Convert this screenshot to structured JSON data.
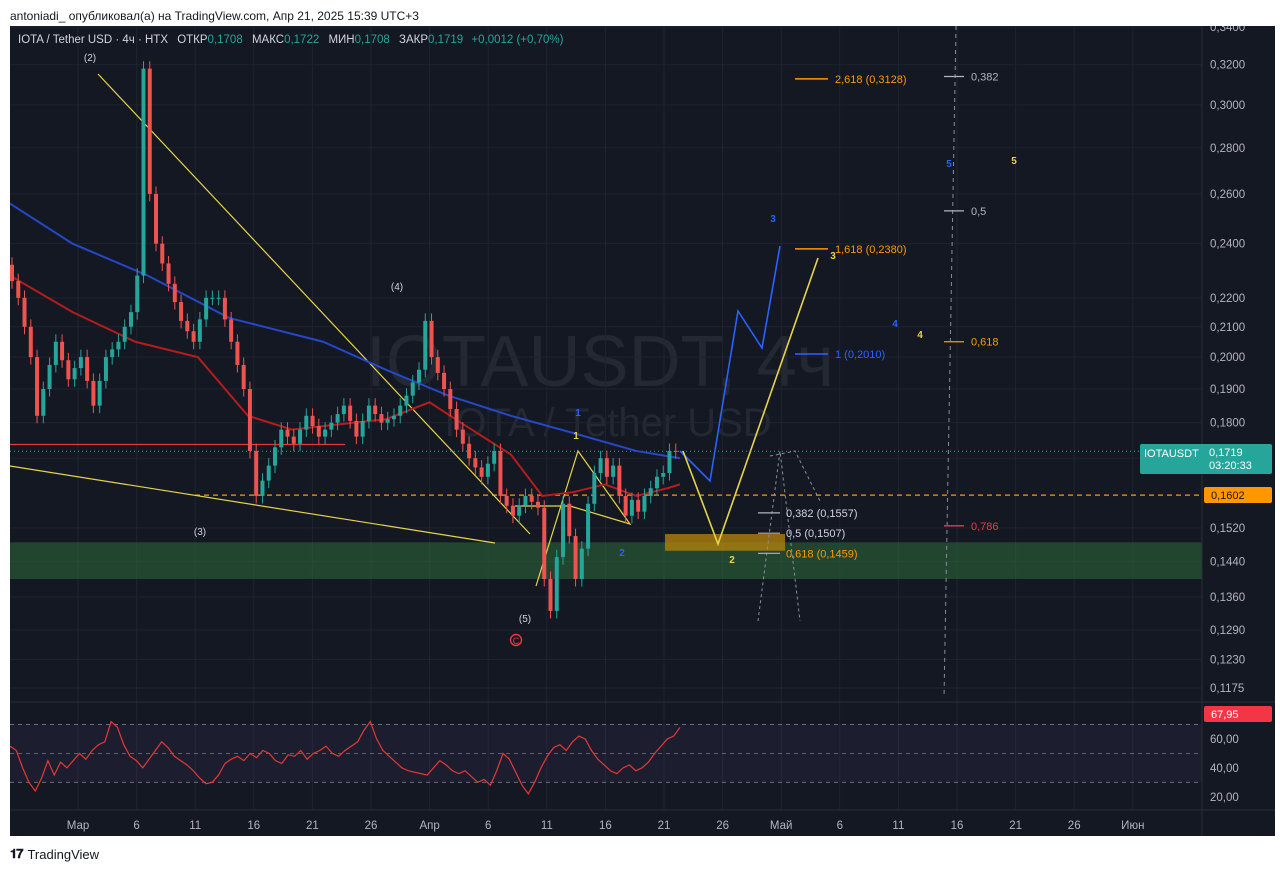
{
  "header": {
    "publisher_line": "antoniadi_ опубликовал(а) на TradingView.com, Апр 21, 2025 15:39 UTC+3"
  },
  "legend": {
    "symbol": "IOTA / Tether USD · 4ч · HTX",
    "open_label": "ОТКР",
    "open": "0,1708",
    "high_label": "МАКС",
    "high": "0,1722",
    "low_label": "МИН",
    "low": "0,1708",
    "close_label": "ЗАКР",
    "close": "0,1719",
    "change": "+0,0012 (+0,70%)"
  },
  "watermark": {
    "line1": "IOTAUSDT, 4ч",
    "line2": "IOTA / Tether USD"
  },
  "price_tag": {
    "symbol": "IOTAUSDT",
    "price": "0,1719",
    "timer": "03:20:33"
  },
  "level_tag": {
    "value": "0,1602"
  },
  "rsi_tag": {
    "value": "67,95"
  },
  "footer": {
    "brand": "TradingView"
  },
  "chart_data": {
    "type": "candlestick",
    "symbol": "IOTAUSDT",
    "timeframe": "4ч",
    "y_scale": "log",
    "y_ticks": [
      0.34,
      0.32,
      0.3,
      0.28,
      0.26,
      0.24,
      0.22,
      0.21,
      0.2,
      0.19,
      0.18,
      0.17,
      0.152,
      0.144,
      0.136,
      0.129,
      0.123,
      0.1175
    ],
    "y_tick_labels": [
      "0,3400",
      "0,3200",
      "0,3000",
      "0,2800",
      "0,2600",
      "0,2400",
      "0,2200",
      "0,2100",
      "0,2000",
      "0,1900",
      "0,1800",
      "0,1700",
      "0,1520",
      "0,1440",
      "0,1360",
      "0,1290",
      "0,1230",
      "0,1175"
    ],
    "x_tick_labels": [
      "Мар",
      "6",
      "11",
      "16",
      "21",
      "26",
      "Апр",
      "6",
      "11",
      "16",
      "21",
      "26",
      "Май",
      "6",
      "11",
      "16",
      "21",
      "26",
      "Июн"
    ],
    "last_price": 0.1719,
    "key_level": 0.1602,
    "price_path": [
      [
        0,
        0.232
      ],
      [
        2,
        0.22
      ],
      [
        4,
        0.2
      ],
      [
        5,
        0.182
      ],
      [
        6,
        0.19
      ],
      [
        8,
        0.205
      ],
      [
        10,
        0.193
      ],
      [
        12,
        0.2
      ],
      [
        14,
        0.185
      ],
      [
        16,
        0.2
      ],
      [
        18,
        0.205
      ],
      [
        20,
        0.215
      ],
      [
        21,
        0.228
      ],
      [
        22,
        0.318
      ],
      [
        23,
        0.26
      ],
      [
        24,
        0.24
      ],
      [
        26,
        0.225
      ],
      [
        28,
        0.212
      ],
      [
        30,
        0.205
      ],
      [
        32,
        0.22
      ],
      [
        34,
        0.22
      ],
      [
        36,
        0.205
      ],
      [
        38,
        0.19
      ],
      [
        39,
        0.172
      ],
      [
        40,
        0.16
      ],
      [
        42,
        0.168
      ],
      [
        44,
        0.178
      ],
      [
        46,
        0.174
      ],
      [
        48,
        0.182
      ],
      [
        50,
        0.176
      ],
      [
        52,
        0.18
      ],
      [
        54,
        0.185
      ],
      [
        56,
        0.176
      ],
      [
        58,
        0.185
      ],
      [
        60,
        0.18
      ],
      [
        62,
        0.182
      ],
      [
        64,
        0.188
      ],
      [
        66,
        0.196
      ],
      [
        67,
        0.212
      ],
      [
        68,
        0.2
      ],
      [
        70,
        0.19
      ],
      [
        72,
        0.178
      ],
      [
        74,
        0.17
      ],
      [
        76,
        0.165
      ],
      [
        78,
        0.172
      ],
      [
        79,
        0.16
      ],
      [
        81,
        0.155
      ],
      [
        83,
        0.16
      ],
      [
        85,
        0.157
      ],
      [
        86,
        0.14
      ],
      [
        87,
        0.133
      ],
      [
        88,
        0.145
      ],
      [
        89,
        0.158
      ],
      [
        90,
        0.15
      ],
      [
        91,
        0.14
      ],
      [
        92,
        0.147
      ],
      [
        93,
        0.158
      ],
      [
        94,
        0.166
      ],
      [
        95,
        0.17
      ],
      [
        96,
        0.165
      ],
      [
        97,
        0.168
      ],
      [
        98,
        0.16
      ],
      [
        99,
        0.155
      ],
      [
        100,
        0.159
      ],
      [
        101,
        0.156
      ],
      [
        102,
        0.16
      ],
      [
        103,
        0.162
      ],
      [
        104,
        0.165
      ],
      [
        105,
        0.166
      ],
      [
        106,
        0.172
      ],
      [
        107,
        0.1719
      ]
    ],
    "ma_blue_path": [
      [
        0,
        0.256
      ],
      [
        10,
        0.24
      ],
      [
        22,
        0.228
      ],
      [
        35,
        0.213
      ],
      [
        50,
        0.205
      ],
      [
        60,
        0.196
      ],
      [
        70,
        0.188
      ],
      [
        80,
        0.182
      ],
      [
        90,
        0.177
      ],
      [
        100,
        0.172
      ],
      [
        107,
        0.17
      ]
    ],
    "ma_red_path": [
      [
        0,
        0.228
      ],
      [
        10,
        0.215
      ],
      [
        20,
        0.205
      ],
      [
        30,
        0.2
      ],
      [
        38,
        0.182
      ],
      [
        45,
        0.178
      ],
      [
        55,
        0.18
      ],
      [
        60,
        0.181
      ],
      [
        67,
        0.186
      ],
      [
        72,
        0.18
      ],
      [
        80,
        0.171
      ],
      [
        85,
        0.16
      ],
      [
        90,
        0.161
      ],
      [
        95,
        0.163
      ],
      [
        100,
        0.16
      ],
      [
        105,
        0.162
      ],
      [
        107,
        0.163
      ]
    ],
    "fib_upper": [
      {
        "label": "2,618 (0,3128)",
        "price": 0.3128
      },
      {
        "label": "1,618 (0,2380)",
        "price": 0.238
      },
      {
        "label": "1 (0,2010)",
        "price": 0.201
      }
    ],
    "fib_lower": [
      {
        "label": "0,382 (0,1557)",
        "price": 0.1557
      },
      {
        "label": "0,5 (0,1507)",
        "price": 0.1507
      },
      {
        "label": "0,618 (0,1459)",
        "price": 0.1459
      }
    ],
    "fib_right": [
      {
        "label": "0,382",
        "price": 0.314
      },
      {
        "label": "0,5",
        "price": 0.253
      },
      {
        "label": "0,618",
        "price": 0.205
      },
      {
        "label": "0,786",
        "price": 0.1525
      }
    ],
    "wave_labels_past": [
      "(2)",
      "(3)",
      "(4)",
      "(5)"
    ],
    "wave_labels_future_yellow": [
      "1",
      "2",
      "3",
      "4",
      "5"
    ],
    "wave_labels_future_blue": [
      "1",
      "2",
      "3",
      "4",
      "5"
    ],
    "rsi": {
      "levels": [
        70,
        50,
        30
      ],
      "y_tick_labels": [
        "60,00",
        "40,00",
        "20,00"
      ],
      "last": 67.95,
      "values": [
        55,
        52,
        40,
        30,
        24,
        33,
        45,
        35,
        44,
        40,
        45,
        50,
        46,
        52,
        56,
        58,
        72,
        68,
        56,
        48,
        45,
        40,
        46,
        52,
        58,
        54,
        48,
        45,
        42,
        38,
        33,
        29,
        30,
        35,
        43,
        46,
        48,
        45,
        50,
        47,
        52,
        50,
        45,
        43,
        49,
        48,
        52,
        46,
        50,
        52,
        55,
        50,
        48,
        52,
        55,
        58,
        66,
        72,
        60,
        52,
        48,
        44,
        40,
        38,
        37,
        36,
        35,
        40,
        45,
        42,
        38,
        36,
        38,
        34,
        30,
        32,
        28,
        38,
        50,
        46,
        37,
        28,
        22,
        30,
        40,
        48,
        54,
        56,
        52,
        58,
        62,
        60,
        52,
        46,
        42,
        38,
        36,
        40,
        42,
        38,
        40,
        44,
        50,
        55,
        60,
        62,
        67.95
      ]
    }
  }
}
